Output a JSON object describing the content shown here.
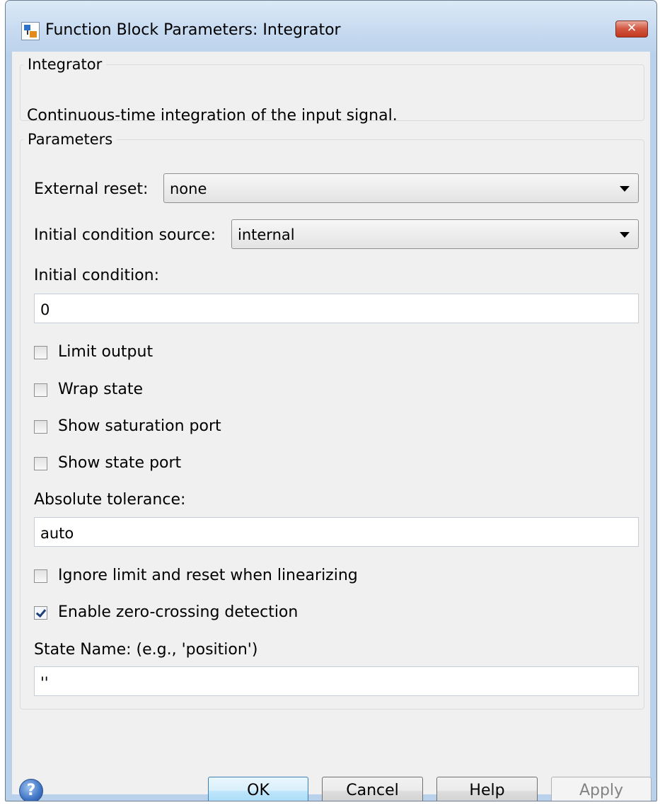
{
  "window": {
    "title": "Function Block Parameters: Integrator",
    "close_label": "✕"
  },
  "description_group": {
    "legend": "Integrator",
    "text": "Continuous-time integration of the input signal."
  },
  "parameters_group": {
    "legend": "Parameters",
    "external_reset": {
      "label": "External reset:",
      "value": "none"
    },
    "initial_condition_source": {
      "label": "Initial condition source:",
      "value": "internal"
    },
    "initial_condition": {
      "label": "Initial condition:",
      "value": "0"
    },
    "checkboxes": [
      {
        "label": "Limit output",
        "checked": false
      },
      {
        "label": "Wrap state",
        "checked": false
      },
      {
        "label": "Show saturation port",
        "checked": false
      },
      {
        "label": "Show state port",
        "checked": false
      }
    ],
    "absolute_tolerance": {
      "label": "Absolute tolerance:",
      "value": "auto"
    },
    "checkboxes2": [
      {
        "label": "Ignore limit and reset when linearizing",
        "checked": false
      },
      {
        "label": "Enable zero-crossing detection",
        "checked": true
      }
    ],
    "state_name": {
      "label": "State Name: (e.g., 'position')",
      "value": "''"
    }
  },
  "buttons": {
    "help_icon": "?",
    "ok": "OK",
    "cancel": "Cancel",
    "help": "Help",
    "apply": "Apply"
  },
  "icons": {
    "app": "simulink-block-icon",
    "close": "close-icon",
    "help": "help-icon"
  },
  "colors": {
    "title_bar": "#c6daf0",
    "close_button": "#c2391f",
    "dialog_bg": "#f0f0f0",
    "default_button": "#bee6fd"
  }
}
